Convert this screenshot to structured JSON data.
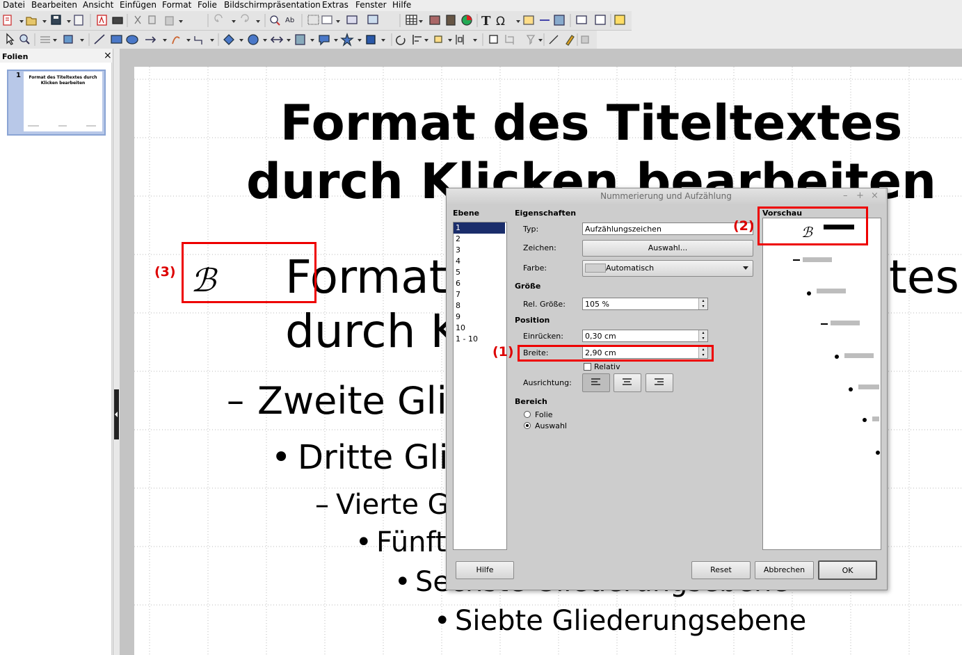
{
  "menubar": {
    "items": [
      "Datei",
      "Bearbeiten",
      "Ansicht",
      "Einfügen",
      "Format",
      "Folie",
      "Bildschirmpräsentation",
      "Extras",
      "Fenster",
      "Hilfe"
    ]
  },
  "toolbar1": {
    "icons": [
      "new-document-icon",
      "open-icon",
      "save-icon",
      "email-icon",
      "edit-file-icon",
      "export-pdf-icon",
      "print-icon",
      "cut-icon",
      "copy-icon",
      "paste-icon",
      "undo-icon",
      "redo-icon",
      "navigator-icon",
      "spellcheck-icon",
      "grid-icon",
      "display-views-icon",
      "slide-icon",
      "presentation-icon",
      "table-icon",
      "image-icon",
      "movie-icon",
      "chart-icon",
      "fontwork-icon",
      "special-character-icon",
      "text-box-icon",
      "hyperlink-icon",
      "gallery-icon",
      "new-slide-icon",
      "layout-icon",
      "slide-design-icon"
    ]
  },
  "toolbar2": {
    "icons": [
      "select-icon",
      "zoom-icon",
      "line-style-icon",
      "area-icon",
      "line-icon",
      "rectangle-icon",
      "ellipse-icon",
      "arrow-icon",
      "curve-icon",
      "connector-icon",
      "basic-shapes-icon",
      "symbol-shapes-icon",
      "block-arrows-icon",
      "flowchart-icon",
      "callouts-icon",
      "stars-icon",
      "3d-objects-icon",
      "rotate-icon",
      "align-icon",
      "arrange-icon",
      "distribute-icon",
      "shadow-icon",
      "crop-icon",
      "filter-icon",
      "points-icon",
      "glue-points-icon",
      "extrusion-icon"
    ]
  },
  "side_pane": {
    "title": "Folien",
    "close": "×",
    "thumb_number": "1",
    "thumb_text": "Format des Titeltextes durch Klicken bearbeiten"
  },
  "slide": {
    "title": "Format des Titeltextes\ndurch Klicken bearbeiten",
    "outline": {
      "level1_line1_a": "Format",
      "level1_line1_b": "tes",
      "level1_line2": "durch K",
      "level2": "Zweite Gli",
      "level3": "Dritte Glie",
      "level4": "Vierte G",
      "level5": "Fünft",
      "level6": "Sechste Gliederungsebene",
      "level7": "Siebte Gliederungsebene"
    },
    "bullets": {
      "level1_symbol": "ℬ",
      "level2": "–",
      "level3": "•",
      "level4": "–",
      "level5": "•",
      "level6": "•",
      "level7": "•"
    }
  },
  "dialog": {
    "title": "Nummerierung und Aufzählung",
    "window_controls": [
      "–",
      "+",
      "×"
    ],
    "levels_header": "Ebene",
    "levels": [
      "1",
      "2",
      "3",
      "4",
      "5",
      "6",
      "7",
      "8",
      "9",
      "10",
      "1 - 10"
    ],
    "properties_header": "Eigenschaften",
    "type_label": "Typ:",
    "type_value": "Aufzählungszeichen",
    "char_label": "Zeichen:",
    "select_button": "Auswahl...",
    "color_label": "Farbe:",
    "color_value": "Automatisch",
    "size_header": "Größe",
    "rel_size_label": "Rel. Größe:",
    "rel_size_value": "105 %",
    "position_header": "Position",
    "indent_label": "Einrücken:",
    "indent_value": "0,30 cm",
    "width_label": "Breite:",
    "width_value": "2,90 cm",
    "relative_label": "Relativ",
    "alignment_label": "Ausrichtung:",
    "range_header": "Bereich",
    "range_slide": "Folie",
    "range_selection": "Auswahl",
    "preview_header": "Vorschau",
    "help_button": "Hilfe",
    "reset_button": "Reset",
    "cancel_button": "Abbrechen",
    "ok_button": "OK"
  },
  "annotations": {
    "label1": "(1)",
    "label2": "(2)",
    "label3": "(3)"
  },
  "colors": {
    "highlight": "#e00000",
    "selection": "#1a2d6b",
    "dialog_bg": "#cdcdcd"
  }
}
